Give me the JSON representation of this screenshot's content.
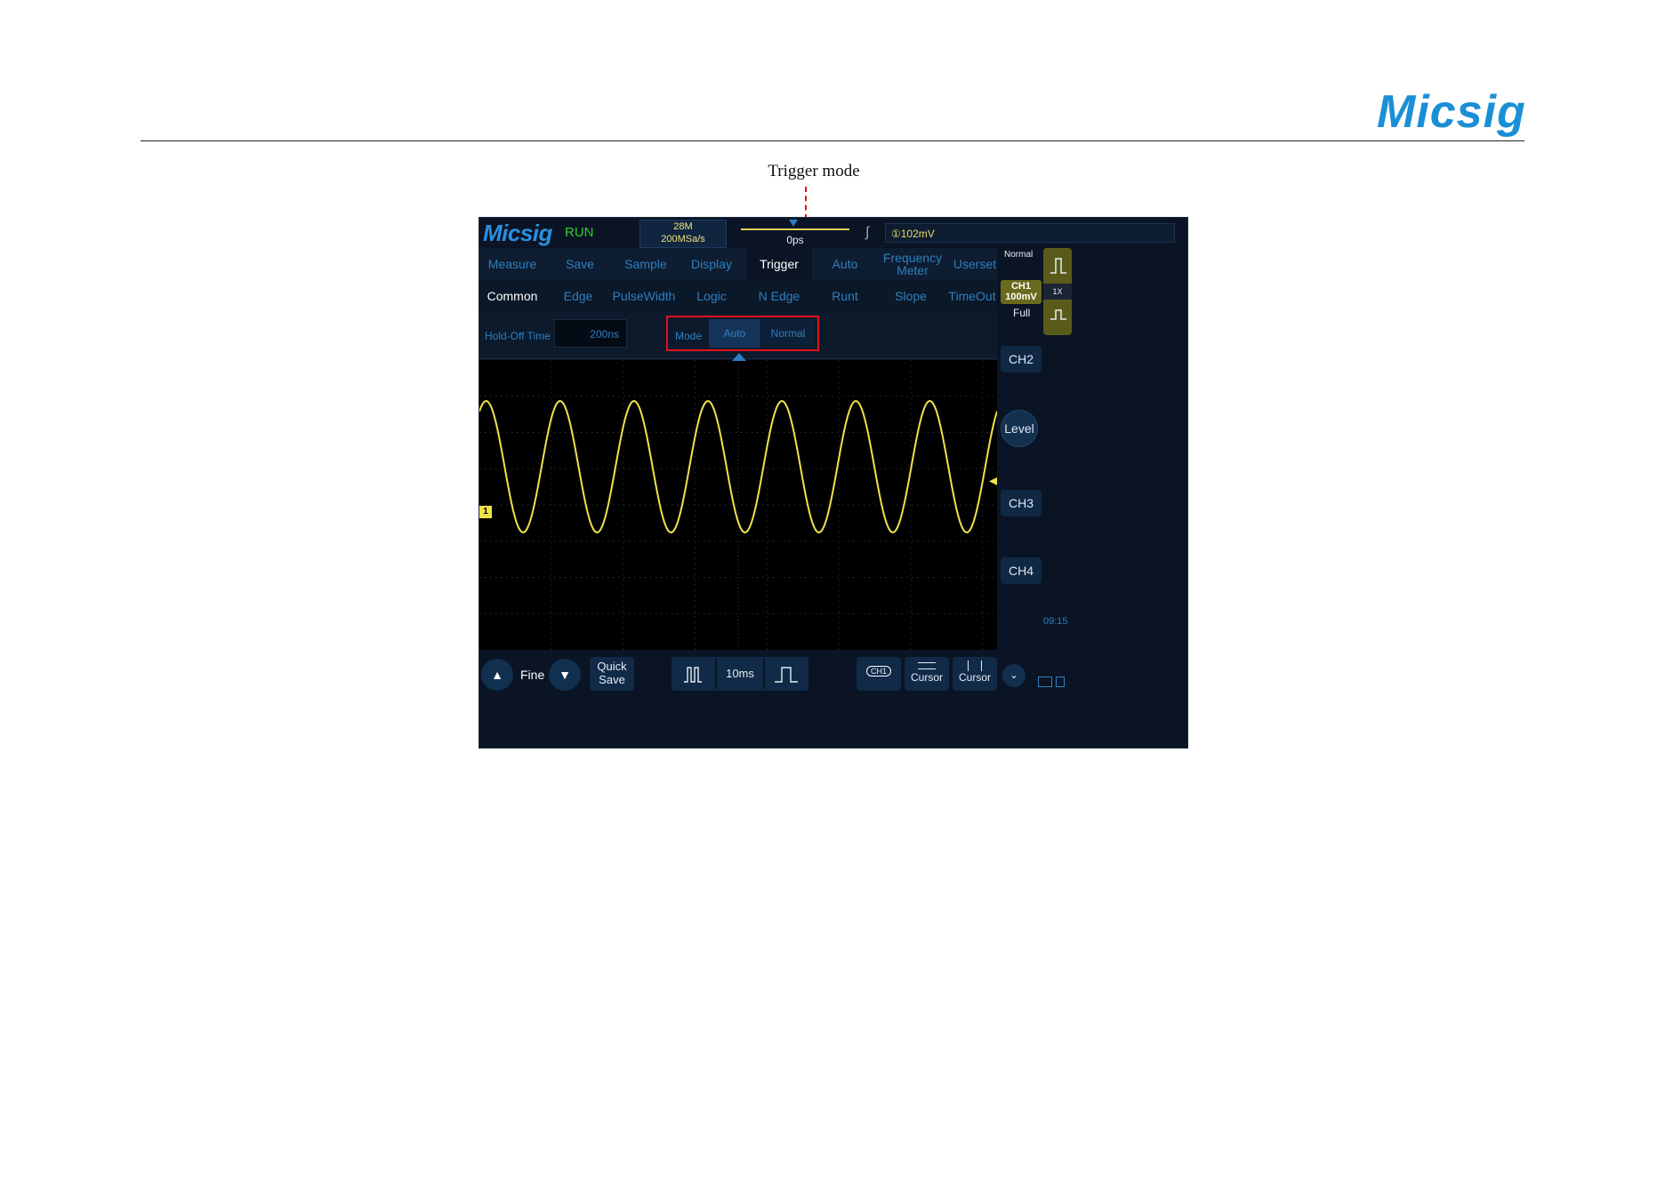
{
  "page": {
    "brand": "Micsig",
    "annotation": "Trigger mode",
    "colors": {
      "brand_blue": "#1a8fd6",
      "annotation_red": "#e3111b",
      "trace_yellow": "#f0e34a",
      "menu_blue": "#2f7fc0"
    }
  },
  "scope": {
    "logo": "Micsig",
    "status": "RUN",
    "memory_depth": "28M",
    "sample_rate": "200MSa/s",
    "time_position": "0ps",
    "trigger_level": "①102mV",
    "menu": {
      "items": [
        "Measure",
        "Save",
        "Sample",
        "Display",
        "Trigger",
        "Auto",
        "Frequency Meter",
        "Userset"
      ],
      "active": "Trigger"
    },
    "trigger_types": {
      "items": [
        "Common",
        "Edge",
        "PulseWidth",
        "Logic",
        "N Edge",
        "Runt",
        "Slope",
        "TimeOut"
      ],
      "active": "Common"
    },
    "options": {
      "holdoff_label": "Hold-Off Time",
      "holdoff_value": "200ns",
      "mode_label": "Mode",
      "mode_auto": "Auto",
      "mode_normal": "Normal",
      "mode_selected": "Auto"
    },
    "right_panel": {
      "trigger_status": "Normal",
      "ch1_label": "CH1",
      "ch1_scale": "100mV",
      "bandwidth": "Full",
      "probe_ratio": "1X",
      "ch2": "CH2",
      "level": "Level",
      "ch3": "CH3",
      "ch4": "CH4",
      "clock": "09:15"
    },
    "channel_marker": "1",
    "bottom": {
      "fine": "Fine",
      "quick_save_1": "Quick",
      "quick_save_2": "Save",
      "timebase": "10ms",
      "ch1_button": "CH1",
      "cursor_h": "Cursor",
      "cursor_v": "Cursor"
    },
    "trace": {
      "channel": "CH1",
      "cycles_visible": 7,
      "color": "#f0e34a"
    }
  }
}
